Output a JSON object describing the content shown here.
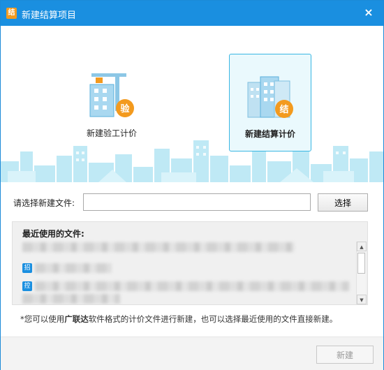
{
  "window": {
    "title": "新建结算项目",
    "title_icon_glyph": "结",
    "close_glyph": "×",
    "accent_color": "#1a8fe0"
  },
  "options": [
    {
      "label": "新建验工计价",
      "badge": "验",
      "icon": "building-crane-icon",
      "selected": false
    },
    {
      "label": "新建结算计价",
      "badge": "结",
      "icon": "buildings-icon",
      "selected": true
    }
  ],
  "file_select": {
    "label": "请选择新建文件:",
    "value": "",
    "button_label": "选择"
  },
  "recent": {
    "heading": "最近使用的文件:",
    "item_glyph_1": "招",
    "item_glyph_2": "控"
  },
  "hint": {
    "prefix": "*您可以使用",
    "brand": "广联达",
    "suffix": "软件格式的计价文件进行新建，也可以选择最近使用的文件直接新建。"
  },
  "footer": {
    "new_label": "新建"
  }
}
